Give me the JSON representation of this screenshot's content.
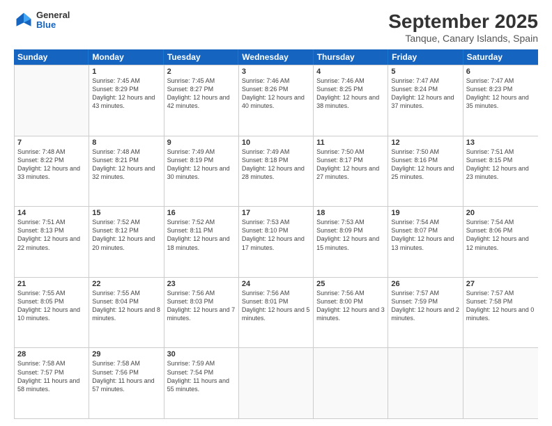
{
  "header": {
    "logo": {
      "line1": "General",
      "line2": "Blue"
    },
    "title": "September 2025",
    "subtitle": "Tanque, Canary Islands, Spain"
  },
  "weekdays": [
    "Sunday",
    "Monday",
    "Tuesday",
    "Wednesday",
    "Thursday",
    "Friday",
    "Saturday"
  ],
  "rows": [
    [
      {
        "day": "",
        "empty": true
      },
      {
        "day": "1",
        "sunrise": "7:45 AM",
        "sunset": "8:29 PM",
        "daylight": "12 hours and 43 minutes."
      },
      {
        "day": "2",
        "sunrise": "7:45 AM",
        "sunset": "8:27 PM",
        "daylight": "12 hours and 42 minutes."
      },
      {
        "day": "3",
        "sunrise": "7:46 AM",
        "sunset": "8:26 PM",
        "daylight": "12 hours and 40 minutes."
      },
      {
        "day": "4",
        "sunrise": "7:46 AM",
        "sunset": "8:25 PM",
        "daylight": "12 hours and 38 minutes."
      },
      {
        "day": "5",
        "sunrise": "7:47 AM",
        "sunset": "8:24 PM",
        "daylight": "12 hours and 37 minutes."
      },
      {
        "day": "6",
        "sunrise": "7:47 AM",
        "sunset": "8:23 PM",
        "daylight": "12 hours and 35 minutes."
      }
    ],
    [
      {
        "day": "7",
        "sunrise": "7:48 AM",
        "sunset": "8:22 PM",
        "daylight": "12 hours and 33 minutes."
      },
      {
        "day": "8",
        "sunrise": "7:48 AM",
        "sunset": "8:21 PM",
        "daylight": "12 hours and 32 minutes."
      },
      {
        "day": "9",
        "sunrise": "7:49 AM",
        "sunset": "8:19 PM",
        "daylight": "12 hours and 30 minutes."
      },
      {
        "day": "10",
        "sunrise": "7:49 AM",
        "sunset": "8:18 PM",
        "daylight": "12 hours and 28 minutes."
      },
      {
        "day": "11",
        "sunrise": "7:50 AM",
        "sunset": "8:17 PM",
        "daylight": "12 hours and 27 minutes."
      },
      {
        "day": "12",
        "sunrise": "7:50 AM",
        "sunset": "8:16 PM",
        "daylight": "12 hours and 25 minutes."
      },
      {
        "day": "13",
        "sunrise": "7:51 AM",
        "sunset": "8:15 PM",
        "daylight": "12 hours and 23 minutes."
      }
    ],
    [
      {
        "day": "14",
        "sunrise": "7:51 AM",
        "sunset": "8:13 PM",
        "daylight": "12 hours and 22 minutes."
      },
      {
        "day": "15",
        "sunrise": "7:52 AM",
        "sunset": "8:12 PM",
        "daylight": "12 hours and 20 minutes."
      },
      {
        "day": "16",
        "sunrise": "7:52 AM",
        "sunset": "8:11 PM",
        "daylight": "12 hours and 18 minutes."
      },
      {
        "day": "17",
        "sunrise": "7:53 AM",
        "sunset": "8:10 PM",
        "daylight": "12 hours and 17 minutes."
      },
      {
        "day": "18",
        "sunrise": "7:53 AM",
        "sunset": "8:09 PM",
        "daylight": "12 hours and 15 minutes."
      },
      {
        "day": "19",
        "sunrise": "7:54 AM",
        "sunset": "8:07 PM",
        "daylight": "12 hours and 13 minutes."
      },
      {
        "day": "20",
        "sunrise": "7:54 AM",
        "sunset": "8:06 PM",
        "daylight": "12 hours and 12 minutes."
      }
    ],
    [
      {
        "day": "21",
        "sunrise": "7:55 AM",
        "sunset": "8:05 PM",
        "daylight": "12 hours and 10 minutes."
      },
      {
        "day": "22",
        "sunrise": "7:55 AM",
        "sunset": "8:04 PM",
        "daylight": "12 hours and 8 minutes."
      },
      {
        "day": "23",
        "sunrise": "7:56 AM",
        "sunset": "8:03 PM",
        "daylight": "12 hours and 7 minutes."
      },
      {
        "day": "24",
        "sunrise": "7:56 AM",
        "sunset": "8:01 PM",
        "daylight": "12 hours and 5 minutes."
      },
      {
        "day": "25",
        "sunrise": "7:56 AM",
        "sunset": "8:00 PM",
        "daylight": "12 hours and 3 minutes."
      },
      {
        "day": "26",
        "sunrise": "7:57 AM",
        "sunset": "7:59 PM",
        "daylight": "12 hours and 2 minutes."
      },
      {
        "day": "27",
        "sunrise": "7:57 AM",
        "sunset": "7:58 PM",
        "daylight": "12 hours and 0 minutes."
      }
    ],
    [
      {
        "day": "28",
        "sunrise": "7:58 AM",
        "sunset": "7:57 PM",
        "daylight": "11 hours and 58 minutes."
      },
      {
        "day": "29",
        "sunrise": "7:58 AM",
        "sunset": "7:56 PM",
        "daylight": "11 hours and 57 minutes."
      },
      {
        "day": "30",
        "sunrise": "7:59 AM",
        "sunset": "7:54 PM",
        "daylight": "11 hours and 55 minutes."
      },
      {
        "day": "",
        "empty": true
      },
      {
        "day": "",
        "empty": true
      },
      {
        "day": "",
        "empty": true
      },
      {
        "day": "",
        "empty": true
      }
    ]
  ]
}
